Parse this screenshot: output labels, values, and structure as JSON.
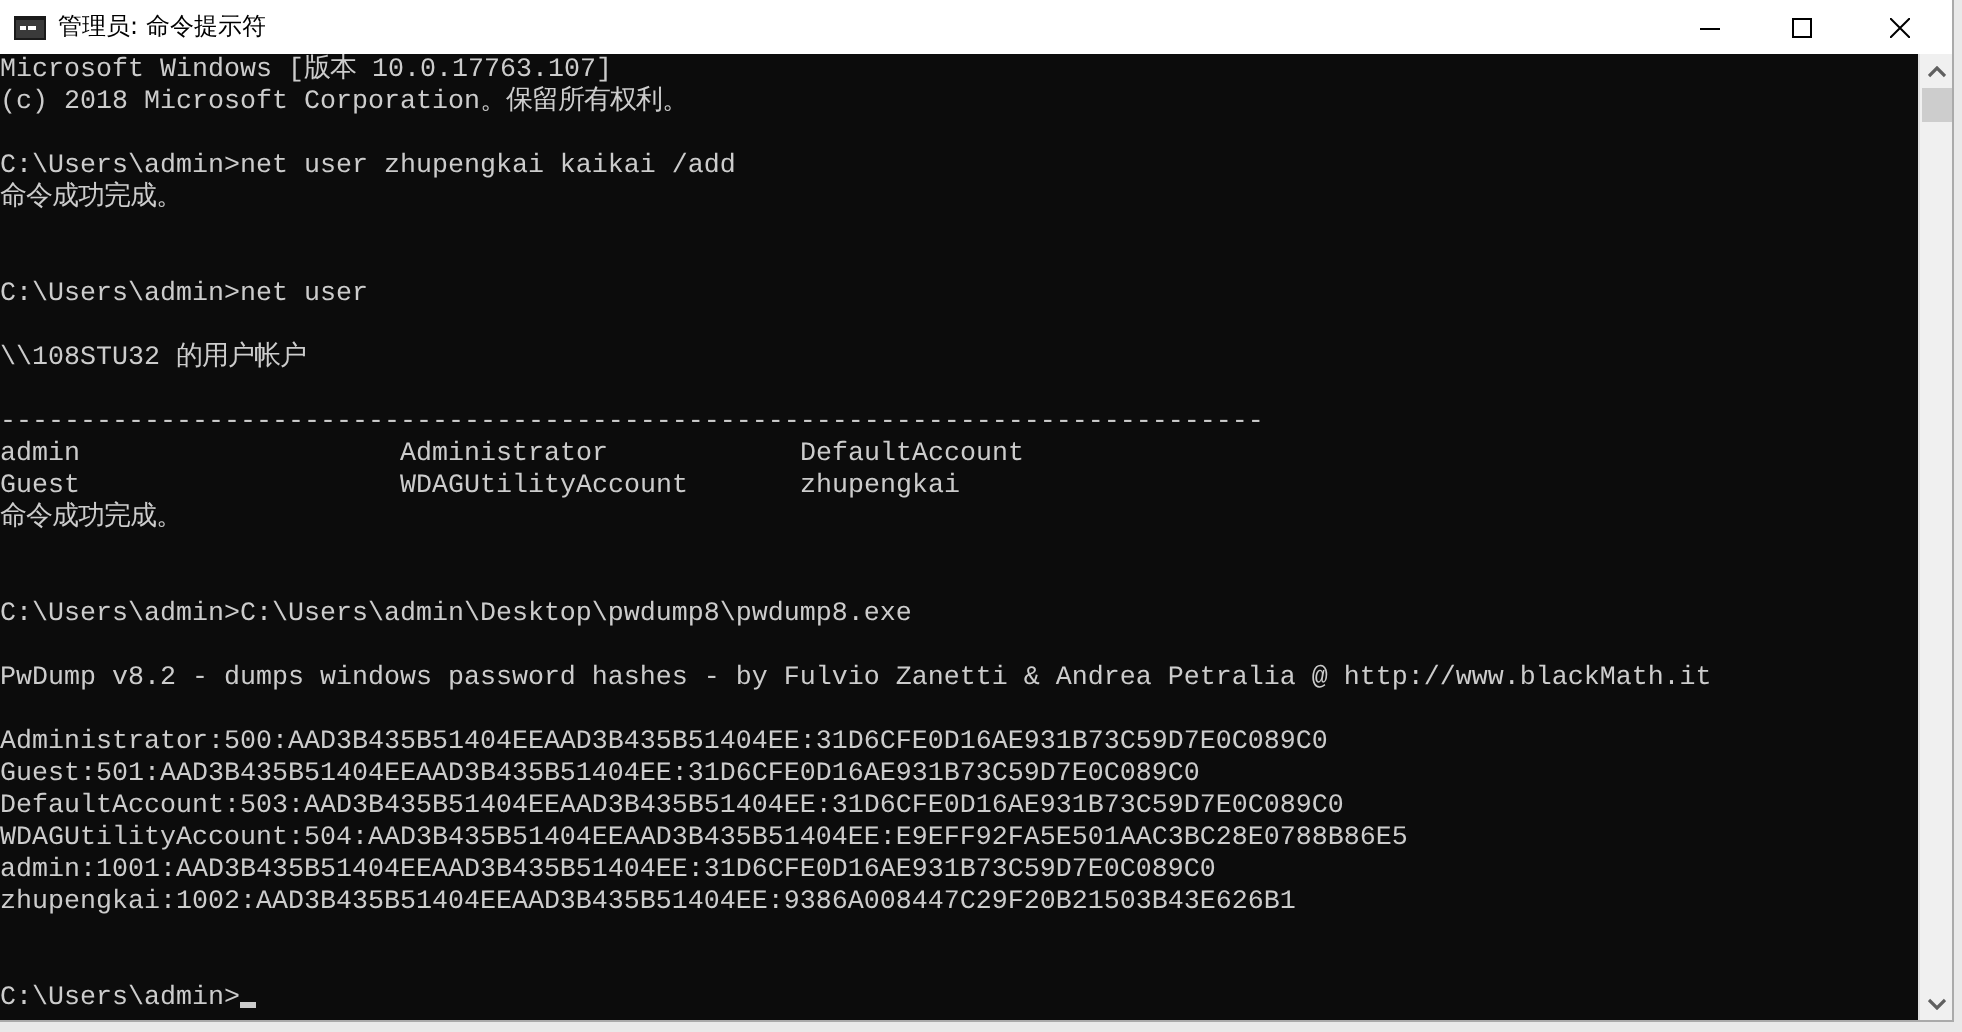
{
  "window": {
    "title": "管理员: 命令提示符",
    "controls": [
      {
        "kind": "minimize"
      },
      {
        "kind": "maximize"
      },
      {
        "kind": "close"
      }
    ]
  },
  "console": {
    "lines": [
      {
        "kind": "text",
        "text": "Microsoft Windows [版本 10.0.17763.107]"
      },
      {
        "kind": "text",
        "text": "(c) 2018 Microsoft Corporation。保留所有权利。"
      },
      {
        "kind": "blank"
      },
      {
        "kind": "text",
        "text": "C:\\Users\\admin>net user zhupengkai kaikai /add"
      },
      {
        "kind": "text",
        "text": "命令成功完成。"
      },
      {
        "kind": "blank"
      },
      {
        "kind": "blank"
      },
      {
        "kind": "text",
        "text": "C:\\Users\\admin>net user"
      },
      {
        "kind": "blank"
      },
      {
        "kind": "text",
        "text": "\\\\108STU32 的用户帐户"
      },
      {
        "kind": "blank"
      },
      {
        "kind": "text",
        "text": "-------------------------------------------------------------------------------"
      },
      {
        "kind": "columns",
        "cells": [
          "admin",
          "Administrator",
          "DefaultAccount"
        ]
      },
      {
        "kind": "columns",
        "cells": [
          "Guest",
          "WDAGUtilityAccount",
          "zhupengkai"
        ]
      },
      {
        "kind": "text",
        "text": "命令成功完成。"
      },
      {
        "kind": "blank"
      },
      {
        "kind": "blank"
      },
      {
        "kind": "text",
        "text": "C:\\Users\\admin>C:\\Users\\admin\\Desktop\\pwdump8\\pwdump8.exe"
      },
      {
        "kind": "blank"
      },
      {
        "kind": "text",
        "text": "PwDump v8.2 - dumps windows password hashes - by Fulvio Zanetti & Andrea Petralia @ http://www.blackMath.it"
      },
      {
        "kind": "blank"
      },
      {
        "kind": "text",
        "text": "Administrator:500:AAD3B435B51404EEAAD3B435B51404EE:31D6CFE0D16AE931B73C59D7E0C089C0"
      },
      {
        "kind": "text",
        "text": "Guest:501:AAD3B435B51404EEAAD3B435B51404EE:31D6CFE0D16AE931B73C59D7E0C089C0"
      },
      {
        "kind": "text",
        "text": "DefaultAccount:503:AAD3B435B51404EEAAD3B435B51404EE:31D6CFE0D16AE931B73C59D7E0C089C0"
      },
      {
        "kind": "text",
        "text": "WDAGUtilityAccount:504:AAD3B435B51404EEAAD3B435B51404EE:E9EFF92FA5E501AAC3BC28E0788B86E5"
      },
      {
        "kind": "text",
        "text": "admin:1001:AAD3B435B51404EEAAD3B435B51404EE:31D6CFE0D16AE931B73C59D7E0C089C0"
      },
      {
        "kind": "text",
        "text": "zhupengkai:1002:AAD3B435B51404EEAAD3B435B51404EE:9386A008447C29F20B21503B43E626B1"
      },
      {
        "kind": "blank"
      },
      {
        "kind": "blank"
      },
      {
        "kind": "prompt",
        "text": "C:\\Users\\admin>",
        "cursor": true
      }
    ]
  }
}
